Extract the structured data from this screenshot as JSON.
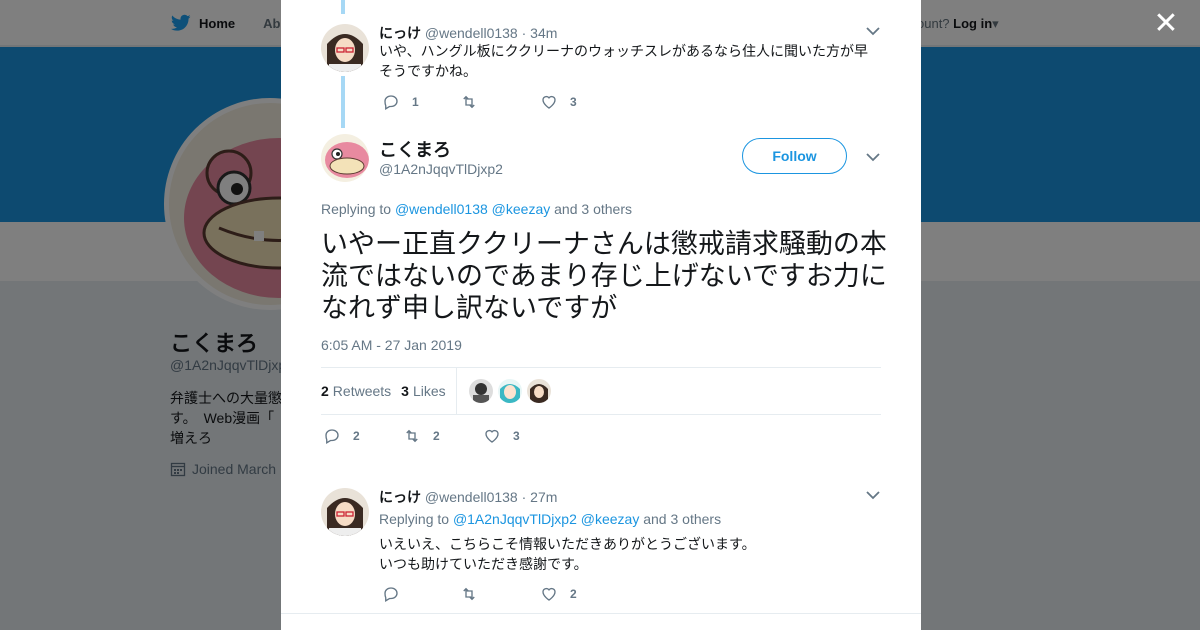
{
  "nav": {
    "home": "Home",
    "about": "Abo",
    "account_prompt": "ccount?",
    "login": "Log in"
  },
  "profile": {
    "name": "こくまろ",
    "handle": "@1A2nJqqvTlDjxp",
    "bio": "弁護士への大量懲\nす。　Web漫画「\n増えろ",
    "joined": "Joined March"
  },
  "modal": {
    "prev_tweet": {
      "name": "にっけ",
      "handle": "@wendell0138",
      "time": "· 34m",
      "text": "いや、ハングル板にククリーナのウォッチスレがあるなら住人に聞いた方が早そうですかね。",
      "replies": "1",
      "retweets": "",
      "likes": "3"
    },
    "main_tweet": {
      "name": "こくまろ",
      "handle": "@1A2nJqqvTlDjxp2",
      "follow_label": "Follow",
      "replying_prefix": "Replying to",
      "mention1": "@wendell0138",
      "mention2": "@keezay",
      "others": "and 3 others",
      "text": "いやー正直ククリーナさんは懲戒請求騒動の本流ではないのであまり存じ上げないですお力になれず申し訳ないですが",
      "timestamp": "6:05 AM - 27 Jan 2019",
      "retweets_count": "2",
      "retweets_label": "Retweets",
      "likes_count": "3",
      "likes_label": "Likes",
      "replies": "2",
      "retweets": "2",
      "likes": "3"
    },
    "reply_tweet": {
      "name": "にっけ",
      "handle": "@wendell0138",
      "time": "· 27m",
      "replying_prefix": "Replying to",
      "mention1": "@1A2nJqqvTlDjxp2",
      "mention2": "@keezay",
      "others": "and 3 others",
      "text_line1": "いえいえ、こちらこそ情報いただきありがとうございます。",
      "text_line2": "いつも助けていただき感謝です。",
      "replies": "",
      "retweets": "",
      "likes": "2"
    }
  },
  "colors": {
    "accent": "#1b95e0",
    "thread": "#a6d8f5",
    "text": "#14171a",
    "muted": "#657786"
  }
}
